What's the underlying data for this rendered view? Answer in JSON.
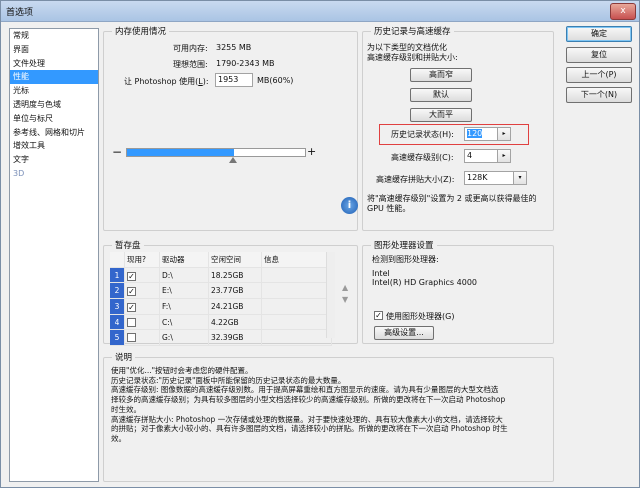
{
  "window": {
    "title": "首选项",
    "close_glyph": "x"
  },
  "sidebar": {
    "items": [
      {
        "label": "常规",
        "selected": false
      },
      {
        "label": "界面",
        "selected": false
      },
      {
        "label": "文件处理",
        "selected": false
      },
      {
        "label": "性能",
        "selected": true
      },
      {
        "label": "光标",
        "selected": false
      },
      {
        "label": "透明度与色域",
        "selected": false
      },
      {
        "label": "单位与标尺",
        "selected": false
      },
      {
        "label": "参考线、网格和切片",
        "selected": false
      },
      {
        "label": "增效工具",
        "selected": false
      },
      {
        "label": "文字",
        "selected": false
      },
      {
        "label": "3D",
        "selected": false,
        "disabled": true
      }
    ]
  },
  "memory": {
    "legend": "内存使用情况",
    "available_label": "可用内存:",
    "available_value": "3255 MB",
    "ideal_label": "理想范围:",
    "ideal_value": "1790-2343 MB",
    "use_label_pre": "让 Photoshop 使用(",
    "use_hotkey": "L",
    "use_label_post": "):",
    "use_value": "1953",
    "use_suffix": "MB(60%)",
    "minus": "−",
    "plus": "+",
    "slider_fraction": 0.6
  },
  "history": {
    "legend": "历史记录与高速缓存",
    "desc_line1": "为以下类型的文档优化",
    "desc_line2": "高速缓存级别和拼贴大小:",
    "btn_tall_thin": "高而窄",
    "btn_default": "默认",
    "btn_big_flat": "大而平",
    "states_label": "历史记录状态(H):",
    "states_value": "120",
    "cache_levels_label": "高速缓存级别(C):",
    "cache_levels_value": "4",
    "tile_size_label": "高速缓存拼贴大小(Z):",
    "tile_size_value": "128K",
    "info_line1": "将\"高速缓存级别\"设置为 2 或更高以获得最佳的",
    "info_line2": "GPU 性能。"
  },
  "scratch": {
    "legend": "暂存盘",
    "headers": [
      "",
      "现用?",
      "驱动器",
      "空闲空间",
      "信息"
    ],
    "rows": [
      {
        "n": "1",
        "active": true,
        "drive": "D:\\",
        "free": "18.25GB",
        "info": ""
      },
      {
        "n": "2",
        "active": true,
        "drive": "E:\\",
        "free": "23.77GB",
        "info": ""
      },
      {
        "n": "3",
        "active": true,
        "drive": "F:\\",
        "free": "24.21GB",
        "info": ""
      },
      {
        "n": "4",
        "active": false,
        "drive": "C:\\",
        "free": "4.22GB",
        "info": ""
      },
      {
        "n": "5",
        "active": false,
        "drive": "G:\\",
        "free": "32.39GB",
        "info": ""
      }
    ],
    "up_glyph": "▲",
    "down_glyph": "▼"
  },
  "gpu": {
    "legend": "图形处理器设置",
    "detected_label": "检测到图形处理器:",
    "vendor": "Intel",
    "model": "Intel(R) HD Graphics 4000",
    "use_gpu_label": "使用图形处理器(G)",
    "use_gpu_checked": true,
    "advanced_btn": "高级设置..."
  },
  "description": {
    "legend": "说明",
    "lines": [
      "使用\"优化...\"按钮时会考虑您的硬件配置。",
      "历史记录状态:\"历史记录\"面板中所能保留的历史记录状态的最大数量。",
      "高速缓存级别: 图像数据的高速缓存级别数。用于提高屏幕重绘和直方图显示的速度。请为具有少量图层的大型文档选",
      "择较多的高速缓存级别；为具有较多图层的小型文档选择较少的高速缓存级别。所做的更改将在下一次启动 Photoshop",
      "时生效。",
      "高速缓存拼贴大小: Photoshop 一次存储或处理的数据量。对于要快速处理的、具有较大像素大小的文档，请选择较大",
      "的拼贴；对于像素大小较小的、具有许多图层的文档，请选择较小的拼贴。所做的更改将在下一次启动 Photoshop 时生",
      "效。"
    ]
  },
  "dialog_buttons": {
    "ok": "确定",
    "reset": "复位",
    "prev": "上一个(P)",
    "next": "下一个(N)"
  },
  "colors": {
    "selection": "#3399ff",
    "highlight_border": "#e04040",
    "accent": "#3c7fb1"
  }
}
